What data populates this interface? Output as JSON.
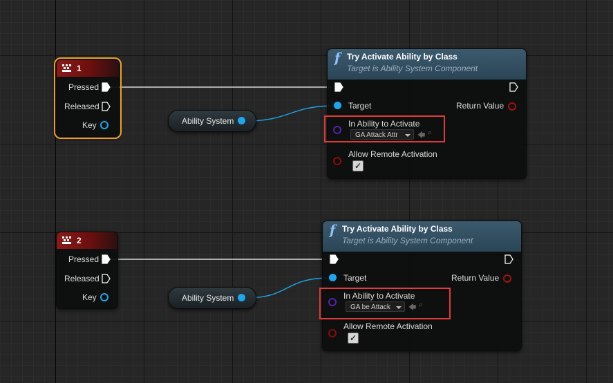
{
  "graph": {
    "background": "#262626"
  },
  "key_nodes": [
    {
      "title": "1",
      "pins": {
        "pressed": "Pressed",
        "released": "Released",
        "key": "Key"
      },
      "selected": true
    },
    {
      "title": "2",
      "pins": {
        "pressed": "Pressed",
        "released": "Released",
        "key": "Key"
      },
      "selected": false
    }
  ],
  "variable_nodes": [
    {
      "label": "Ability System"
    },
    {
      "label": "Ability System"
    }
  ],
  "function_nodes": [
    {
      "glyph": "f",
      "title": "Try Activate Ability by Class",
      "subtitle": "Target is Ability System Component",
      "target_label": "Target",
      "return_label": "Return Value",
      "ability_label": "In Ability to Activate",
      "ability_value": "GA Attack Attr",
      "remote_label": "Allow Remote Activation",
      "remote_checked": true
    },
    {
      "glyph": "f",
      "title": "Try Activate Ability by Class",
      "subtitle": "Target is Ability System Component",
      "target_label": "Target",
      "return_label": "Return Value",
      "ability_label": "In Ability to Activate",
      "ability_value": "GA be Attack",
      "remote_label": "Allow Remote Activation",
      "remote_checked": true
    }
  ],
  "colors": {
    "exec_pin": "#ffffff",
    "object_pin": "#1aa7ec",
    "class_pin": "#5a1fb0",
    "bool_pin": "#8c0a0a",
    "highlight": "#e23b3b",
    "selection": "#f0a020"
  },
  "icons": {
    "function": "function-f-icon",
    "keyboard": "keyboard-icon",
    "checkmark": "check-icon"
  }
}
